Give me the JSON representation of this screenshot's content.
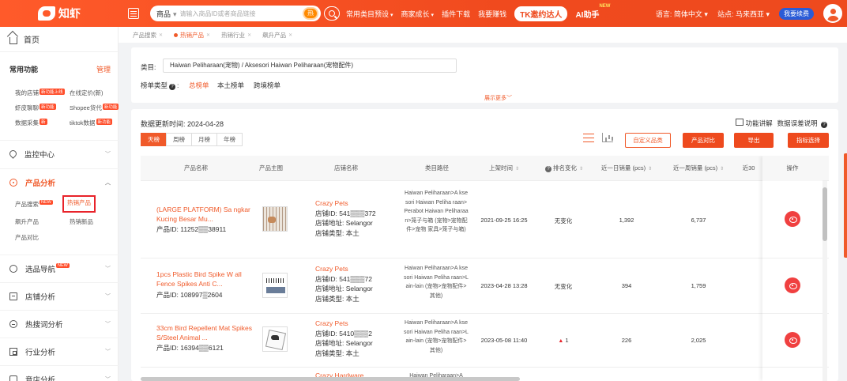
{
  "topbar": {
    "logo_text": "知虾",
    "search_type": "商品",
    "search_placeholder": "请输入商品ID或者商品链接",
    "hot_label": "热",
    "nav": [
      {
        "label": "常用类目预设",
        "has_caret": true
      },
      {
        "label": "商家成长",
        "has_caret": true
      },
      {
        "label": "插件下载",
        "has_caret": false
      },
      {
        "label": "我要赚钱",
        "has_caret": false
      }
    ],
    "tk_label": "TK邀约达人",
    "ai_label": "AI助手",
    "ai_badge": "NEW",
    "language_label": "语言: 简体中文",
    "site_label": "站点: 马来西亚",
    "renew_label": "我要续费"
  },
  "sidebar": {
    "home": "首页",
    "common_title": "常用功能",
    "manage": "管理",
    "common_links": [
      {
        "label": "我的店铺",
        "badge": "新功能上线"
      },
      {
        "label": "在线定价(新)",
        "badge": ""
      },
      {
        "label": "虾皮聊聊",
        "badge": "新功能"
      },
      {
        "label": "Shopee货代",
        "badge": "新功能"
      },
      {
        "label": "数据采集",
        "badge": "新"
      },
      {
        "label": "tiktok数据",
        "badge": "新功能"
      }
    ],
    "monitor": "监控中心",
    "product_analysis": "产品分析",
    "product_sub": [
      {
        "label": "产品搜索",
        "badge": "NEW"
      },
      {
        "label": "热销产品",
        "badge": ""
      },
      {
        "label": "飙升产品",
        "badge": ""
      },
      {
        "label": "热销新品",
        "badge": ""
      },
      {
        "label": "产品对比",
        "badge": ""
      }
    ],
    "selection_nav": "选品导航",
    "selection_badge": "NEW",
    "store_analysis": "店铺分析",
    "hot_search": "热搜词分析",
    "industry": "行业分析",
    "competitor": "竞店分析"
  },
  "tabs": [
    {
      "label": "产品搜索",
      "active": false
    },
    {
      "label": "热销产品",
      "active": true
    },
    {
      "label": "热销行业",
      "active": false
    },
    {
      "label": "飙升产品",
      "active": false
    }
  ],
  "filter": {
    "category_label": "类目:",
    "category_value": "Haiwan Peliharaan(宠物) / Aksesori Haiwan Peliharaan(宠物配件)",
    "rank_type_label": "榜单类型",
    "rank_options": [
      "总榜单",
      "本土榜单",
      "跨境榜单"
    ],
    "active_rank": 0,
    "more_label": "展示更多"
  },
  "content": {
    "updated": "数据更新时间: 2024-04-28",
    "periods": [
      "天榜",
      "周榜",
      "月榜",
      "年榜"
    ],
    "active_period": 0,
    "func_explain": "功能讲解",
    "data_error": "数据误差说明",
    "buttons": {
      "custom": "自定义品类",
      "compare": "产品对比",
      "export": "导出",
      "indicators": "指标选择"
    }
  },
  "table": {
    "headers": {
      "name": "产品名称",
      "image": "产品主图",
      "store": "店铺名称",
      "category": "类目路径",
      "listed": "上架时间",
      "rank_change": "排名变化",
      "sales_1d": "近一日销量 (pcs)",
      "sales_7d": "近一周销量 (pcs)",
      "sales_30d": "近30",
      "op": "操作"
    },
    "rows": [
      {
        "name": "(LARGE PLATFORM) Sa ngkar Kucing Besar Mu...",
        "pid": "产品ID: 11252▒▒38911",
        "thumb": "cage",
        "store_name": "Crazy Pets",
        "store_id": "店铺ID: 541▒▒▒372",
        "store_addr": "店铺地址: Selangor",
        "store_type": "店铺类型: 本土",
        "category": "Haiwan Peliharaan>A ksesori Haiwan Peliha raan>Perabot Haiwan Peliharaan>笼子与箱 (宠物>宠物配件>宠物 家具>笼子与箱)",
        "listed": "2021-09-25 16:25",
        "rank_change": "无变化",
        "rank_up": false,
        "sales_1d": "1,392",
        "sales_7d": "6,737"
      },
      {
        "name": "1pcs Plastic Bird Spike W all Fence Spikes Anti C...",
        "pid": "产品ID: 108997▒2604",
        "thumb": "spike",
        "store_name": "Crazy Pets",
        "store_id": "店铺ID: 541▒▒▒72",
        "store_addr": "店铺地址: Selangor",
        "store_type": "店铺类型: 本土",
        "category": "Haiwan Peliharaan>A ksesori Haiwan Peliha raan>Lain-lain (宠物>宠物配件>其他)",
        "listed": "2023-04-28 13:28",
        "rank_change": "无变化",
        "rank_up": false,
        "sales_1d": "394",
        "sales_7d": "1,759"
      },
      {
        "name": "33cm Bird Repellent Mat Spikes S/Steel Animal ...",
        "pid": "产品ID: 16394▒▒6121",
        "thumb": "bird",
        "store_name": "Crazy Pets",
        "store_id": "店铺ID: 5410▒▒▒2",
        "store_addr": "店铺地址: Selangor",
        "store_type": "店铺类型: 本土",
        "category": "Haiwan Peliharaan>A ksesori Haiwan Peliha raan>Lain-lain (宠物>宠物配件>其他)",
        "listed": "2023-05-08 11:40",
        "rank_change": "1",
        "rank_up": true,
        "sales_1d": "226",
        "sales_7d": "2,025"
      }
    ],
    "partial_store": "Crazy Hardware",
    "partial_category": "Haiwan Peliharaan>A"
  },
  "colors": {
    "accent": "#f05a2a",
    "topbar": "#ee4a1e",
    "danger": "#f04040",
    "renew": "#2a5bd7"
  }
}
